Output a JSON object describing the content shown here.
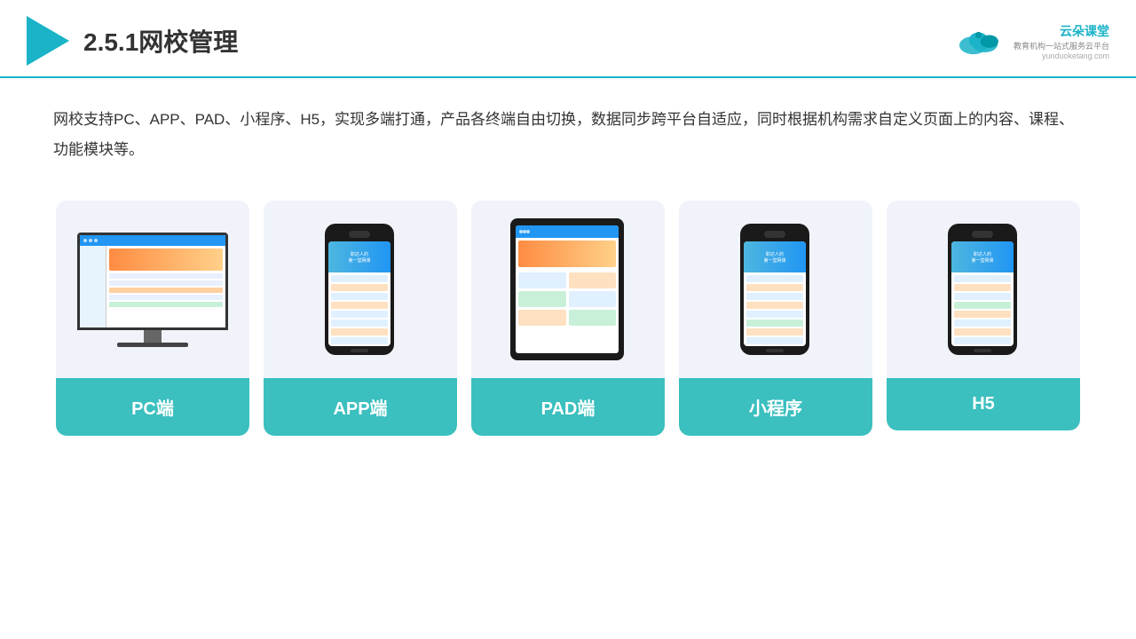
{
  "header": {
    "title": "2.5.1网校管理",
    "brand": {
      "name": "云朵课堂",
      "tagline": "教育机构一站式服务云平台",
      "url": "yunduoketang.com"
    }
  },
  "description": "网校支持PC、APP、PAD、小程序、H5，实现多端打通，产品各终端自由切换，数据同步跨平台自适应，同时根据机构需求自定义页面上的内容、课程、功能模块等。",
  "cards": [
    {
      "id": "pc",
      "label": "PC端"
    },
    {
      "id": "app",
      "label": "APP端"
    },
    {
      "id": "pad",
      "label": "PAD端"
    },
    {
      "id": "miniprogram",
      "label": "小程序"
    },
    {
      "id": "h5",
      "label": "H5"
    }
  ],
  "colors": {
    "accent": "#1ab3c8",
    "card_bg": "#f0f4fa",
    "label_bg": "#3bbfbf"
  }
}
